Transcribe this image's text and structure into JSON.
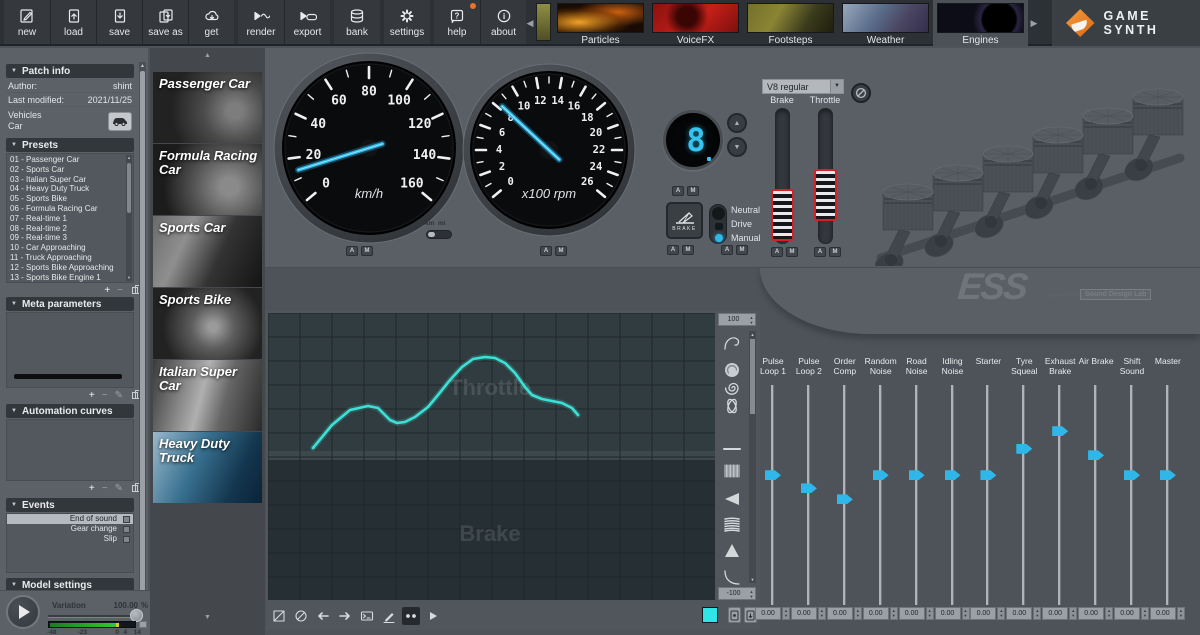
{
  "toolbar": {
    "buttons": [
      {
        "label": "new",
        "icon": "doc-new",
        "group": 1
      },
      {
        "label": "load",
        "icon": "doc-load",
        "group": 1
      },
      {
        "label": "save",
        "icon": "doc-save",
        "group": 1
      },
      {
        "label": "save as",
        "icon": "doc-saveas",
        "group": 1
      },
      {
        "label": "get",
        "icon": "cloud-get",
        "group": 1
      },
      {
        "label": "render",
        "icon": "render-wave",
        "group": 2
      },
      {
        "label": "export",
        "icon": "export-gamepad",
        "group": 2
      },
      {
        "label": "bank",
        "icon": "database",
        "group": 3
      },
      {
        "label": "settings",
        "icon": "gear",
        "group": 4
      },
      {
        "label": "help",
        "icon": "help",
        "group": 5,
        "badge": true
      },
      {
        "label": "about",
        "icon": "info",
        "group": 5
      }
    ]
  },
  "model_tabs": [
    {
      "label": "Particles",
      "active": false
    },
    {
      "label": "VoiceFX",
      "active": false
    },
    {
      "label": "Footsteps",
      "active": false
    },
    {
      "label": "Weather",
      "active": false
    },
    {
      "label": "Engines",
      "active": true
    }
  ],
  "brand": {
    "name": "GAME SYNTH",
    "accent_color": "#e8822a"
  },
  "sidebar": {
    "sections": {
      "patch_info": "Patch info",
      "presets": "Presets",
      "meta_parameters": "Meta parameters",
      "automation_curves": "Automation curves",
      "events": "Events",
      "model_settings": "Model settings"
    },
    "patch_info": {
      "author_label": "Author:",
      "author": "shint",
      "modified_label": "Last modified:",
      "modified": "2021/11/25",
      "category": "Vehicles",
      "subcategory": "Car"
    },
    "presets": [
      "01 - Passenger Car",
      "02 - Sports Car",
      "03 - Italian Super Car",
      "04 - Heavy Duty Truck",
      "05 - Sports Bike",
      "06 - Formula Racing Car",
      "07 - Real-time 1",
      "08 - Real-time 2",
      "09 - Real-time 3",
      "10 - Car Approaching",
      "11 - Truck Approaching",
      "12 - Sports Bike Approaching",
      "13 - Sports Bike Engine 1"
    ],
    "events": [
      {
        "label": "End of sound",
        "selected": true
      },
      {
        "label": "Gear change",
        "selected": false
      },
      {
        "label": "Slip",
        "selected": false
      }
    ]
  },
  "transport": {
    "variation_label": "Variation",
    "variation_value": "100.00",
    "variation_unit": "%",
    "meter_ticks": [
      {
        "label": "-48",
        "pct": 3
      },
      {
        "label": "-23",
        "pct": 33
      },
      {
        "label": "0",
        "pct": 70
      },
      {
        "label": "4",
        "pct": 78
      },
      {
        "label": "14",
        "pct": 88
      }
    ]
  },
  "vehicles": [
    {
      "label": "Passenger Car",
      "selected": false
    },
    {
      "label": "Formula Racing Car",
      "selected": false
    },
    {
      "label": "Sports Car",
      "selected": false
    },
    {
      "label": "Sports Bike",
      "selected": false
    },
    {
      "label": "Italian Super Car",
      "selected": false
    },
    {
      "label": "Heavy Duty Truck",
      "selected": true
    }
  ],
  "dashboard": {
    "speedometer": {
      "min": 0,
      "max": 160,
      "label_step": 20,
      "minor_step": 10,
      "unit": "km/h",
      "value": 14
    },
    "tachometer": {
      "min": 0,
      "max": 26,
      "label_step": 2,
      "minor_step": 1,
      "unit": "x100 rpm",
      "value": 8.3
    },
    "unit_toggle": {
      "left": "km",
      "right": "mi",
      "selected": "km"
    },
    "gear_display": "8",
    "engine_type": "V8 regular",
    "brake_button": "BRAKE",
    "transmission": {
      "options": [
        "Neutral",
        "Drive",
        "Manual"
      ],
      "selected": "Manual"
    },
    "brake_slider": {
      "label": "Brake",
      "position_pct": 97
    },
    "throttle_slider": {
      "label": "Throttle",
      "position_pct": 73
    },
    "am_labels": [
      "A",
      "M"
    ],
    "needle_color": "#2eb7e8"
  },
  "ess": {
    "logo": "ESS",
    "powered_by": "powered by",
    "company": "Sound Design Lab"
  },
  "curve_editor": {
    "labels": {
      "top": "Throttle",
      "bottom": "Brake"
    },
    "range_top": "100",
    "range_bottom": "-100",
    "curve_color": "#3ce1d6",
    "curve_points": [
      [
        45,
        135
      ],
      [
        64,
        112
      ],
      [
        82,
        97
      ],
      [
        100,
        93
      ],
      [
        110,
        95
      ],
      [
        122,
        107
      ],
      [
        129,
        110
      ],
      [
        137,
        109
      ],
      [
        147,
        104
      ],
      [
        160,
        94
      ],
      [
        170,
        82
      ],
      [
        182,
        67
      ],
      [
        194,
        54
      ],
      [
        205,
        46
      ],
      [
        217,
        44
      ],
      [
        227,
        45
      ],
      [
        237,
        50
      ],
      [
        247,
        60
      ],
      [
        257,
        74
      ],
      [
        264,
        82
      ],
      [
        274,
        86
      ],
      [
        284,
        88
      ],
      [
        294,
        90
      ],
      [
        304,
        95
      ],
      [
        310,
        102
      ]
    ],
    "curve_tools": [
      "arc",
      "scribble",
      "spiral",
      "loops",
      "line",
      "noise-band",
      "noise-wedge",
      "coil",
      "noise-triangle",
      "curve-down"
    ],
    "editor_tools": [
      {
        "name": "marquee",
        "active": false
      },
      {
        "name": "slash",
        "active": false
      },
      {
        "name": "arrow-left",
        "active": false
      },
      {
        "name": "arrow-right",
        "active": false
      },
      {
        "name": "prompt",
        "active": false
      },
      {
        "name": "pencil",
        "active": false
      },
      {
        "name": "dots",
        "active": true
      },
      {
        "name": "play",
        "active": false
      }
    ]
  },
  "mixer": {
    "sliders": [
      {
        "label": "Pulse Loop 1",
        "value": "0.00",
        "handle_pct": 41
      },
      {
        "label": "Pulse Loop 2",
        "value": "0.00",
        "handle_pct": 47
      },
      {
        "label": "Order Comp",
        "value": "0.00",
        "handle_pct": 52
      },
      {
        "label": "Random Noise",
        "value": "0.00",
        "handle_pct": 41
      },
      {
        "label": "Road Noise",
        "value": "0.00",
        "handle_pct": 41
      },
      {
        "label": "Idling Noise",
        "value": "0.00",
        "handle_pct": 41
      },
      {
        "label": "Starter",
        "value": "0.00",
        "handle_pct": 41
      },
      {
        "label": "Tyre Squeal",
        "value": "0.00",
        "handle_pct": 29
      },
      {
        "label": "Exhaust Brake",
        "value": "0.00",
        "handle_pct": 21
      },
      {
        "label": "Air Brake",
        "value": "0.00",
        "handle_pct": 32
      },
      {
        "label": "Shift Sound",
        "value": "0.00",
        "handle_pct": 41
      },
      {
        "label": "Master",
        "value": "0.00",
        "handle_pct": 41
      }
    ],
    "handle_color": "#2eb7e8"
  }
}
